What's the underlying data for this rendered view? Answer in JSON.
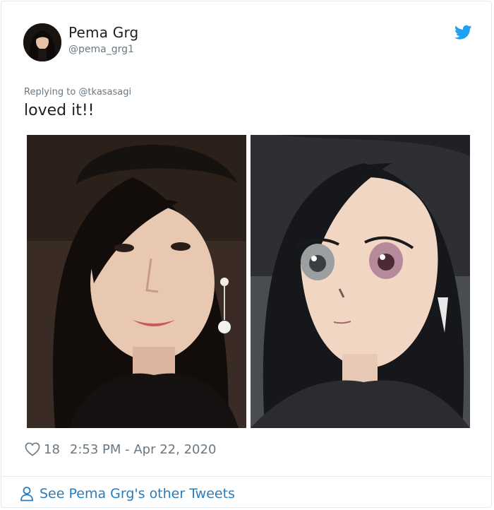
{
  "author": {
    "display_name": "Pema Grg",
    "handle": "@pema_grg1",
    "avatar_icon": "user-avatar"
  },
  "brand": {
    "icon": "twitter-bird-icon",
    "color": "#1da1f2"
  },
  "tweet": {
    "replying_to": "Replying to @tkasasagi",
    "text": "loved it!!",
    "photos": [
      {
        "kind": "photo",
        "subject": "real-portrait"
      },
      {
        "kind": "illustration",
        "subject": "anime-portrait"
      }
    ]
  },
  "meta": {
    "like_icon": "heart-icon",
    "likes": "18",
    "timestamp": "2:53 PM - Apr 22, 2020"
  },
  "footer": {
    "icon": "person-icon",
    "link_text": "See Pema Grg's other Tweets"
  }
}
